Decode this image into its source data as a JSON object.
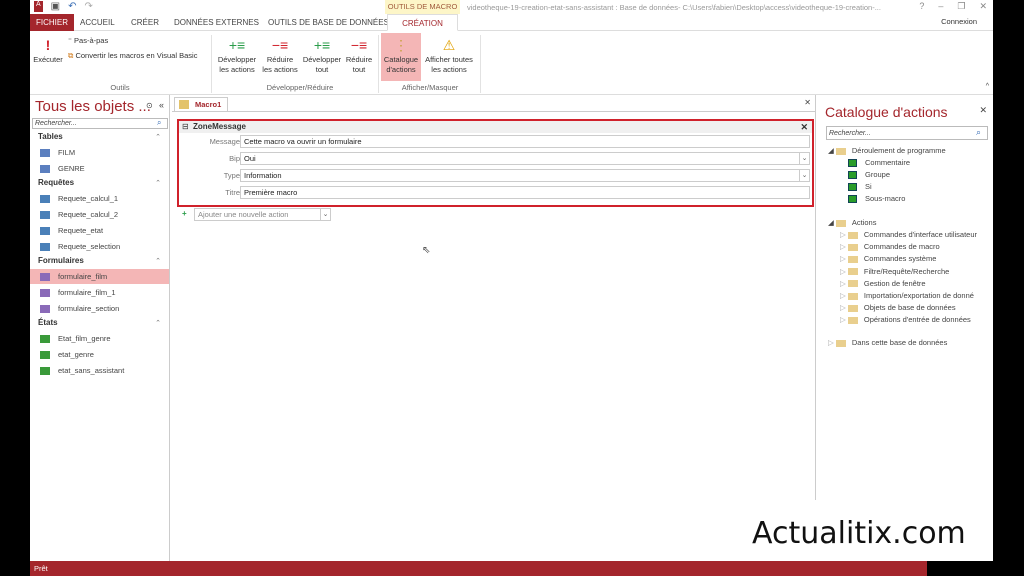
{
  "titlebar": {
    "context_tab": "OUTILS DE MACRO",
    "title": "videotheque-19-creation-etat-sans-assistant : Base de données- C:\\Users\\fabien\\Desktop\\access\\videotheque-19-creation-...",
    "help": "?",
    "minimize": "–",
    "restore": "❐",
    "close": "✕"
  },
  "tabs": [
    "FICHIER",
    "ACCUEIL",
    "CRÉER",
    "DONNÉES EXTERNES",
    "OUTILS DE BASE DE DONNÉES",
    "CRÉATION"
  ],
  "signin": "Connexion",
  "ribbon": {
    "run": "Exécuter",
    "step": "Pas-à-pas",
    "convert": "Convertir les macros en Visual Basic",
    "group_tools": "Outils",
    "expand_actions": [
      "Développer",
      "les actions"
    ],
    "collapse_actions": [
      "Réduire",
      "les actions"
    ],
    "expand_all": [
      "Développer",
      "tout"
    ],
    "collapse_all": [
      "Réduire",
      "tout"
    ],
    "group_expand": "Développer/Réduire",
    "catalog": [
      "Catalogue",
      "d'actions"
    ],
    "show_all": [
      "Afficher toutes",
      "les actions"
    ],
    "group_show": "Afficher/Masquer"
  },
  "nav": {
    "title": "Tous les objets ...",
    "search": "Rechercher...",
    "groups": [
      {
        "name": "Tables",
        "items": [
          "FILM",
          "GENRE"
        ]
      },
      {
        "name": "Requêtes",
        "items": [
          "Requete_calcul_1",
          "Requete_calcul_2",
          "Requete_etat",
          "Requete_selection"
        ]
      },
      {
        "name": "Formulaires",
        "items": [
          "formulaire_film",
          "formulaire_film_1",
          "formulaire_section"
        ]
      },
      {
        "name": "États",
        "items": [
          "Etat_film_genre",
          "etat_genre",
          "etat_sans_assistant"
        ]
      }
    ]
  },
  "doc": {
    "tab": "Macro1",
    "action": "ZoneMessage",
    "fields": [
      {
        "label": "Message",
        "value": "Cette macro va ouvrir un formulaire"
      },
      {
        "label": "Bip",
        "value": "Oui"
      },
      {
        "label": "Type",
        "value": "Information"
      },
      {
        "label": "Titre",
        "value": "Première macro"
      }
    ],
    "add_action": "Ajouter une nouvelle action"
  },
  "catalog": {
    "title": "Catalogue d'actions",
    "search": "Rechercher...",
    "flow": "Déroulement de programme",
    "flow_items": [
      "Commentaire",
      "Groupe",
      "Si",
      "Sous-macro"
    ],
    "actions": "Actions",
    "action_items": [
      "Commandes d'interface utilisateur",
      "Commandes de macro",
      "Commandes système",
      "Filtre/Requête/Recherche",
      "Gestion de fenêtre",
      "Importation/exportation de donné",
      "Objets de base de données",
      "Opérations d'entrée de données"
    ],
    "in_db": "Dans cette base de données"
  },
  "status": "Prêt",
  "watermark": "Actualitix.com",
  "colors": {
    "accent": "#a4262c",
    "highlight": "#d0212b"
  }
}
